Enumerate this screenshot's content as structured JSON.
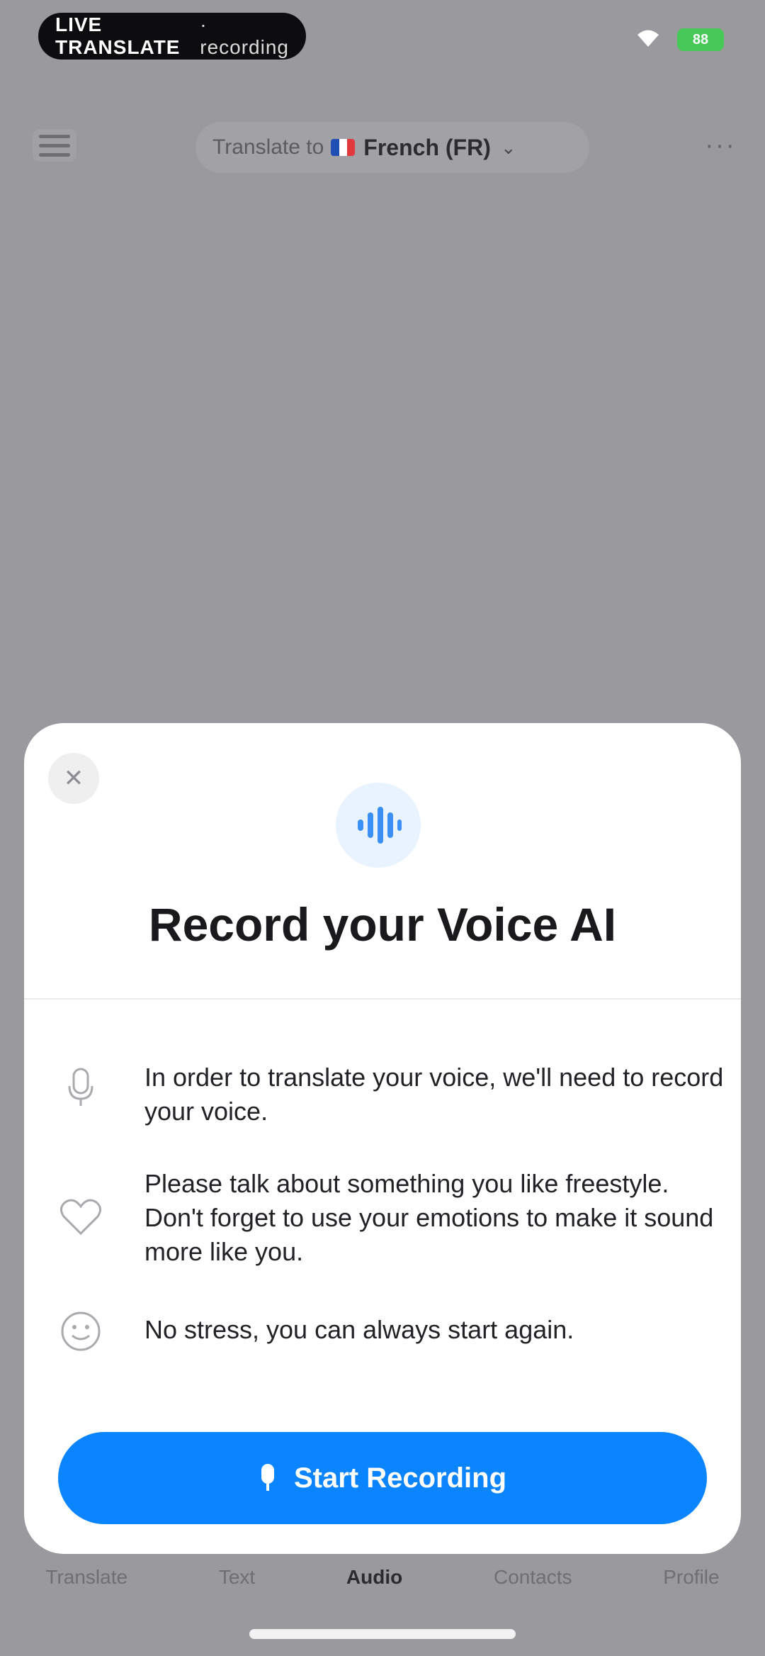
{
  "status_bar": {
    "live_label_bold": "LIVE TRANSLATE",
    "live_label_light": "· recording",
    "battery_text": "88"
  },
  "header": {
    "translate_prefix": "Translate to",
    "language": "French (FR)",
    "chevron": "⌄",
    "more_glyph": "···"
  },
  "tabs": [
    {
      "label": "Translate"
    },
    {
      "label": "Text"
    },
    {
      "label": "Audio"
    },
    {
      "label": "Contacts"
    },
    {
      "label": "Profile"
    }
  ],
  "sheet": {
    "close_glyph": "✕",
    "title": "Record your Voice AI",
    "items": [
      {
        "icon": "microphone-icon",
        "text": "In order to translate your voice, we'll need to record your voice."
      },
      {
        "icon": "heart-icon",
        "text": "Please talk about something you like freestyle. Don't forget to use your emotions to make it sound more like you."
      },
      {
        "icon": "smile-icon",
        "text": "No stress, you can always start again."
      }
    ],
    "button_label": "Start Recording"
  },
  "colors": {
    "accent": "#0a84ff",
    "backdrop": "#9a999d",
    "battery": "#47c957"
  }
}
